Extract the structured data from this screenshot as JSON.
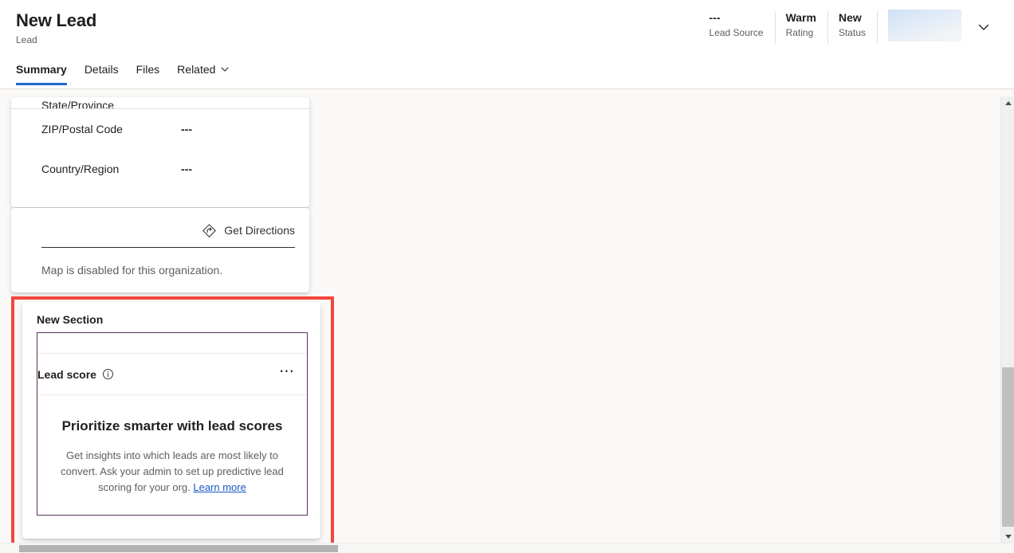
{
  "header": {
    "title": "New Lead",
    "subtitle": "Lead",
    "fields": [
      {
        "value": "---",
        "label": "Lead Source"
      },
      {
        "value": "Warm",
        "label": "Rating"
      },
      {
        "value": "New",
        "label": "Status"
      }
    ],
    "skeleton_name": "loading-skeleton-block",
    "chevron_name": "chevron-down-icon"
  },
  "tabs": [
    {
      "label": "Summary",
      "active": true
    },
    {
      "label": "Details",
      "active": false
    },
    {
      "label": "Files",
      "active": false
    },
    {
      "label": "Related",
      "active": false,
      "has_chevron": true
    }
  ],
  "address_card": {
    "clipped_row_label": "State/Province",
    "rows": [
      {
        "label": "ZIP/Postal Code",
        "value": "---"
      },
      {
        "label": "Country/Region",
        "value": "---"
      }
    ]
  },
  "map_card": {
    "directions_label": "Get Directions",
    "directions_icon": "get-directions-icon",
    "disabled_message": "Map is disabled for this organization."
  },
  "new_section": {
    "section_title": "New Section",
    "lead_score": {
      "title": "Lead score",
      "info_icon": "info-circle-icon",
      "overflow_label": "• • •",
      "empty_heading": "Prioritize smarter with lead scores",
      "empty_desc_prefix": "Get insights into which leads are most likely to convert. Ask your admin to set up predictive lead scoring for your org. ",
      "learn_more_label": "Learn more"
    }
  },
  "scrollbars": {
    "vertical_up_icon": "scroll-up-arrow-icon",
    "vertical_down_icon": "scroll-down-arrow-icon"
  },
  "colors": {
    "accent_blue": "#2266cc",
    "link_blue": "#1a58c4",
    "highlight_red": "#f4453c",
    "control_purple": "#5c2e63",
    "page_bg": "#faf9f8"
  }
}
